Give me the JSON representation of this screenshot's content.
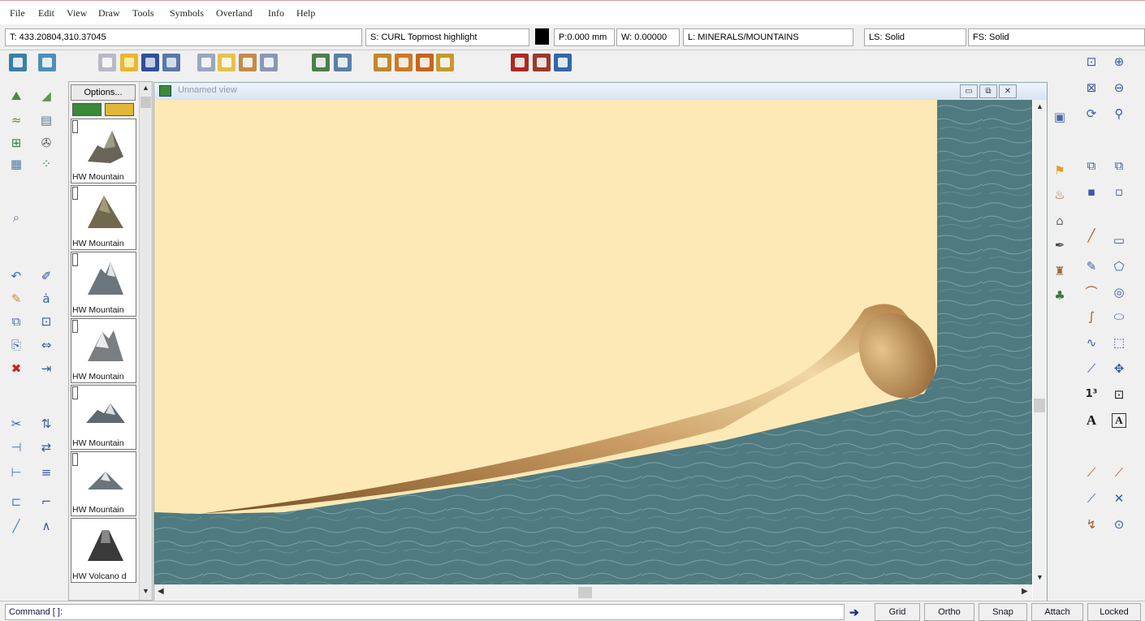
{
  "menu": [
    "File",
    "Edit",
    "View",
    "Draw",
    "Tools",
    "Symbols",
    "Overland",
    "Info",
    "Help"
  ],
  "status": {
    "coords": "T: 433.20804,310.37045",
    "sheet": "S: CURL Topmost highlight",
    "color": "#000000",
    "pen": "P:0.000 mm",
    "width": "W: 0.00000",
    "layer": "L: MINERALS/MOUNTAINS",
    "line_style": "LS: Solid",
    "fill_style": "FS: Solid"
  },
  "catalog": {
    "options_label": "Options...",
    "items": [
      {
        "label": "HW Mountain"
      },
      {
        "label": "HW Mountain"
      },
      {
        "label": "HW Mountain"
      },
      {
        "label": "HW Mountain"
      },
      {
        "label": "HW Mountain"
      },
      {
        "label": "HW Mountain"
      },
      {
        "label": "HW Volcano d"
      }
    ]
  },
  "window": {
    "title": "Unnamed view",
    "minimize": "▭",
    "restore": "⧉",
    "close": "✕"
  },
  "map": {
    "parchment_color": "#fde9b6",
    "water_color": "#4f7a80",
    "curl_color": "#b8864e"
  },
  "command": {
    "prompt": "Command [ ]:"
  },
  "modes": [
    "Grid",
    "Ortho",
    "Snap",
    "Attach",
    "Locked"
  ],
  "toolbar_icons": {
    "left_a": [
      "map-icon",
      "map-nav-icon",
      "map-zoom-icon",
      "grid-icon",
      "map-view-icon",
      "find-icon",
      "undo-icon",
      "eraser-icon",
      "copy-icon",
      "paste-icon",
      "delete-icon",
      "trim-icon",
      "break-icon",
      "divide-icon",
      "explode-icon",
      "line-icon"
    ],
    "left_b": [
      "terrain-icon",
      "layers-icon",
      "tools-icon",
      "dots-icon",
      "pen-icon",
      "text-icon",
      "group-icon",
      "move-icon",
      "extend-icon",
      "sort-icon",
      "mirror-icon",
      "list-icon",
      "frame-icon",
      "angle-icon"
    ],
    "right_a": [
      "flag-icon",
      "cake-icon",
      "house-icon",
      "feather-icon",
      "castle-icon",
      "tree-icon"
    ],
    "right_b": [
      "zoom-window-icon",
      "zoom-extents-icon",
      "redraw-icon",
      "move-icon",
      "front-icon",
      "line-tool-icon",
      "pen-tool-icon",
      "arc-icon",
      "curve-icon",
      "spline-icon",
      "polyline-icon",
      "text-number-icon",
      "text-a-icon",
      "line-draw-icon",
      "line-edit-icon",
      "measure-icon"
    ],
    "right_c": [
      "zoom-in-icon",
      "zoom-out-icon",
      "zoom-prev-icon",
      "copy-layer-icon",
      "back-icon",
      "rect-icon",
      "poly-icon",
      "circle-icon",
      "ellipse-icon",
      "box-icon",
      "shape-icon",
      "frame-text-icon",
      "text-box-icon",
      "pen-line-icon",
      "cross-icon",
      "circle-point-icon"
    ]
  }
}
